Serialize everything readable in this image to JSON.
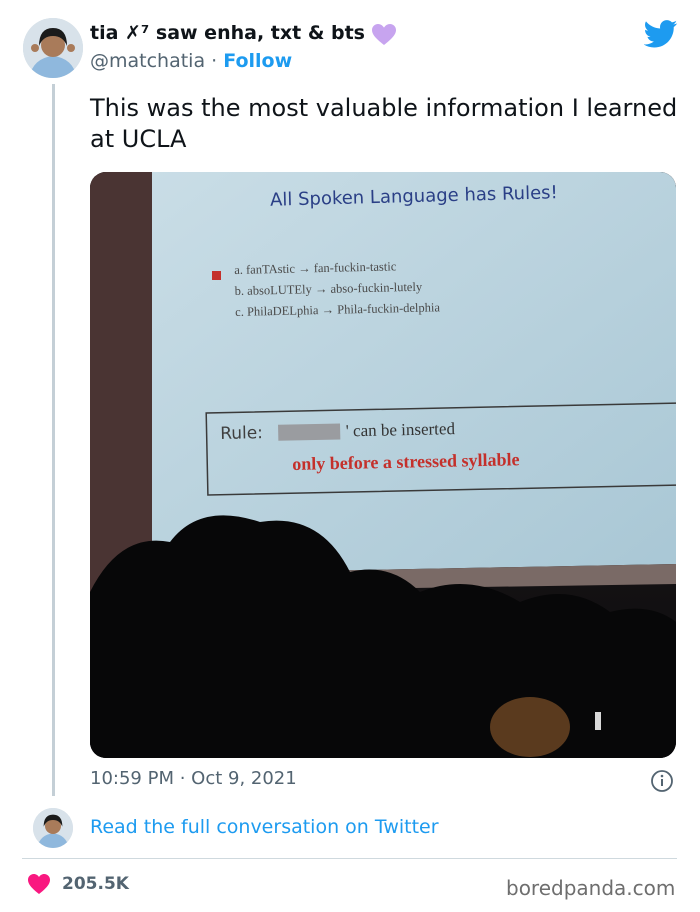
{
  "author": {
    "display_name": "tia ✗⁷ saw enha, txt & bts",
    "handle": "@matchatia",
    "separator": "·",
    "follow_label": "Follow"
  },
  "tweet": {
    "text": "This was the most valuable information I learned at UCLA",
    "timestamp": "10:59 PM · Oct 9, 2021"
  },
  "photo": {
    "slide_title": "All Spoken Language has Rules!",
    "examples": [
      "a. fanTAstic → fan-fuckin-tastic",
      "b. absoLUTEly → abso-fuckin-lutely",
      "c. PhilaDELphia → Phila-fuckin-delphia"
    ],
    "rule_label": "Rule:",
    "rule_text": "' can be inserted",
    "rule_highlight": "only before a stressed syllable"
  },
  "footer": {
    "read_more": "Read the full conversation on Twitter",
    "like_count": "205.5K",
    "watermark": "boredpanda.com"
  },
  "colors": {
    "accent": "#1d9bf0",
    "like": "#f91880",
    "badge_heart": "#c7a4ef",
    "slide_red": "#c4302b",
    "slide_title_blue": "#2a3f86"
  }
}
